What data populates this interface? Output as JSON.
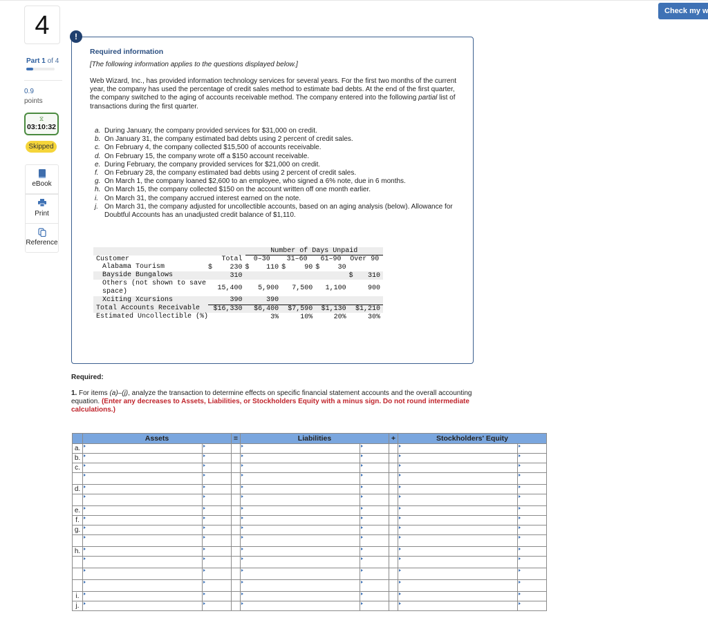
{
  "header": {
    "check_button_label": "Check my work"
  },
  "rail": {
    "question_number": "4",
    "part_word": "Part",
    "part_current": "1",
    "part_of": "of 4",
    "part_progress": 0.25,
    "points_value": "0.9",
    "points_label": "points",
    "timer_icon": "hourglass-icon",
    "timer": "03:10:32",
    "status_badge": "Skipped",
    "tools": [
      {
        "label": "eBook",
        "icon": "book-icon"
      },
      {
        "label": "Print",
        "icon": "printer-icon"
      },
      {
        "label": "Reference",
        "icon": "copy-icon"
      }
    ]
  },
  "info": {
    "alert_icon": "!",
    "title": "Required information",
    "subtitle": "[The following information applies to the questions displayed below.]",
    "paragraph_before_italic": "Web Wizard, Inc., has provided information technology services for several years. For the first two months of the current year, the company has used the percentage of credit sales method to estimate bad debts. At the end of the first quarter, the company switched to the aging of accounts receivable method. The company entered into the following ",
    "paragraph_italic": "partial",
    "paragraph_after_italic": " list of transactions during the first quarter.",
    "transactions": [
      {
        "letter": "a.",
        "text": "During January, the company provided services for $31,000 on credit."
      },
      {
        "letter": "b.",
        "text": "On January 31, the company estimated bad debts using 2 percent of credit sales."
      },
      {
        "letter": "c.",
        "text": "On February 4, the company collected $15,500 of accounts receivable."
      },
      {
        "letter": "d.",
        "text": "On February 15, the company wrote off a $150 account receivable."
      },
      {
        "letter": "e.",
        "text": "During February, the company provided services for $21,000 on credit."
      },
      {
        "letter": "f.",
        "text": "On February 28, the company estimated bad debts using 2 percent of credit sales."
      },
      {
        "letter": "g.",
        "text": "On March 1, the company loaned $2,600 to an employee, who signed a 6% note, due in 6 months."
      },
      {
        "letter": "h.",
        "text": "On March 15, the company collected $150 on the account written off one month earlier."
      },
      {
        "letter": "i.",
        "text": "On March 31, the company accrued interest earned on the note."
      },
      {
        "letter": "j.",
        "text": "On March 31, the company adjusted for uncollectible accounts, based on an aging analysis (below). Allowance for Doubtful Accounts has an unadjusted credit balance of $1,110."
      }
    ]
  },
  "aging": {
    "group_header": "Number of Days Unpaid",
    "columns": [
      "Customer",
      "Total",
      "0–30",
      "31–60",
      "61–90",
      "Over 90"
    ],
    "rows": [
      {
        "customer": "Alabama Tourism",
        "total": "230",
        "total_dollar": "$",
        "d0_30": "110",
        "d0_30_dollar": "$",
        "d31_60": "90",
        "d31_60_dollar": "$",
        "d61_90": "30",
        "d61_90_dollar": "$",
        "over90": "",
        "over90_dollar": ""
      },
      {
        "customer": "Bayside Bungalows",
        "total": "310",
        "total_dollar": "",
        "d0_30": "",
        "d0_30_dollar": "",
        "d31_60": "",
        "d31_60_dollar": "",
        "d61_90": "",
        "d61_90_dollar": "",
        "over90": "310",
        "over90_dollar": "$"
      },
      {
        "customer": "Others (not shown to save space)",
        "total": "15,400",
        "total_dollar": "",
        "d0_30": "5,900",
        "d0_30_dollar": "",
        "d31_60": "7,500",
        "d31_60_dollar": "",
        "d61_90": "1,100",
        "d61_90_dollar": "",
        "over90": "900",
        "over90_dollar": ""
      },
      {
        "customer": "Xciting Xcursions",
        "total": "390",
        "total_dollar": "",
        "d0_30": "390",
        "d0_30_dollar": "",
        "d31_60": "",
        "d31_60_dollar": "",
        "d61_90": "",
        "d61_90_dollar": "",
        "over90": "",
        "over90_dollar": ""
      }
    ],
    "total_row": {
      "label": "Total Accounts Receivable",
      "total": "$16,330",
      "d0_30": "$6,400",
      "d31_60": "$7,590",
      "d61_90": "$1,130",
      "over90": "$1,210"
    },
    "pct_row": {
      "label": "Estimated Uncollectible (%)",
      "total": "",
      "d0_30": "3%",
      "d31_60": "10%",
      "d61_90": "20%",
      "over90": "30%"
    }
  },
  "required": {
    "label": "Required:",
    "q_number": "1.",
    "q_text_1": "For items ",
    "q_italic": "(a)–(j)",
    "q_text_2": ", analyze the transaction to determine effects on specific financial statement accounts and the overall accounting equation. ",
    "q_red": "(Enter any decreases to Assets, Liabilities, or Stockholders Equity with a minus sign. Do not round intermediate calculations.)"
  },
  "grid": {
    "headers": {
      "assets": "Assets",
      "equals": "=",
      "liabilities": "Liabilities",
      "plus": "+",
      "equity": "Stockholders' Equity"
    },
    "rows": [
      {
        "label": "a."
      },
      {
        "label": "b."
      },
      {
        "label": "c."
      },
      {
        "label": ""
      },
      {
        "label": "d."
      },
      {
        "label": ""
      },
      {
        "label": "e."
      },
      {
        "label": "f."
      },
      {
        "label": "g."
      },
      {
        "label": ""
      },
      {
        "label": "h."
      },
      {
        "label": ""
      },
      {
        "label": ""
      },
      {
        "label": ""
      },
      {
        "label": "i."
      },
      {
        "label": "j."
      }
    ]
  },
  "colors": {
    "accent": "#3f72b5",
    "grid_header": "#7aa6de",
    "info_border": "#3b5f8f",
    "instruction_red": "#c0262d",
    "timer_green": "#4a8a3f",
    "skipped_yellow": "#f5d53a"
  }
}
